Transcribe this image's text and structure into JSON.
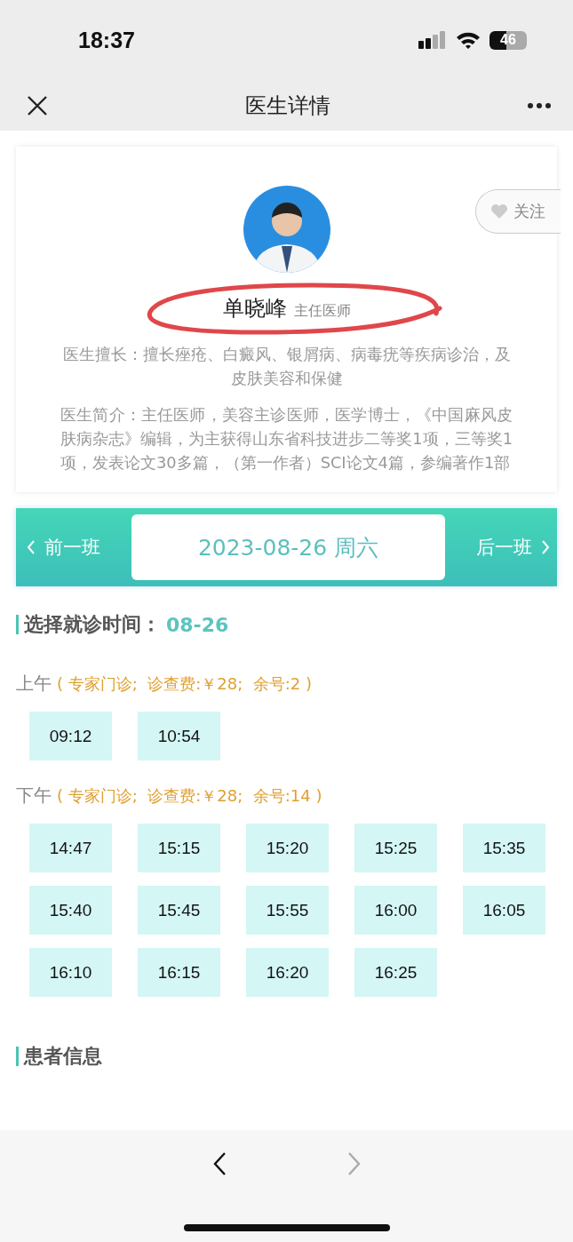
{
  "status_bar": {
    "time": "18:37",
    "battery": "46"
  },
  "nav": {
    "title": "医生详情"
  },
  "doctor": {
    "name": "单晓峰",
    "title": "主任医师",
    "follow": "关注",
    "specialty": "医生擅长：擅长痤疮、白癜风、银屑病、病毒疣等疾病诊治，及皮肤美容和保健",
    "intro": "医生简介：主任医师，美容主诊医师，医学博士，《中国麻风皮肤病杂志》编辑，为主获得山东省科技进步二等奖1项，三等奖1项，发表论文30多篇，（第一作者）SCI论文4篇，参编著作1部"
  },
  "date_bar": {
    "prev": "前一班",
    "date": "2023-08-26 周六",
    "next": "后一班"
  },
  "schedule": {
    "heading": "选择就诊时间：",
    "date": "08-26",
    "sessions": [
      {
        "label": "上午",
        "info": "( 专家门诊;  诊查费:￥28;  余号:2 )",
        "slots": [
          "09:12",
          "10:54"
        ]
      },
      {
        "label": "下午",
        "info": "( 专家门诊;  诊查费:￥28;  余号:14 )",
        "slots": [
          "14:47",
          "15:15",
          "15:20",
          "15:25",
          "15:35",
          "15:40",
          "15:45",
          "15:55",
          "16:00",
          "16:05",
          "16:10",
          "16:15",
          "16:20",
          "16:25"
        ]
      }
    ]
  },
  "patient": {
    "heading": "患者信息"
  },
  "browser_bar": {
    "back_disabled": false,
    "forward_disabled": true
  }
}
